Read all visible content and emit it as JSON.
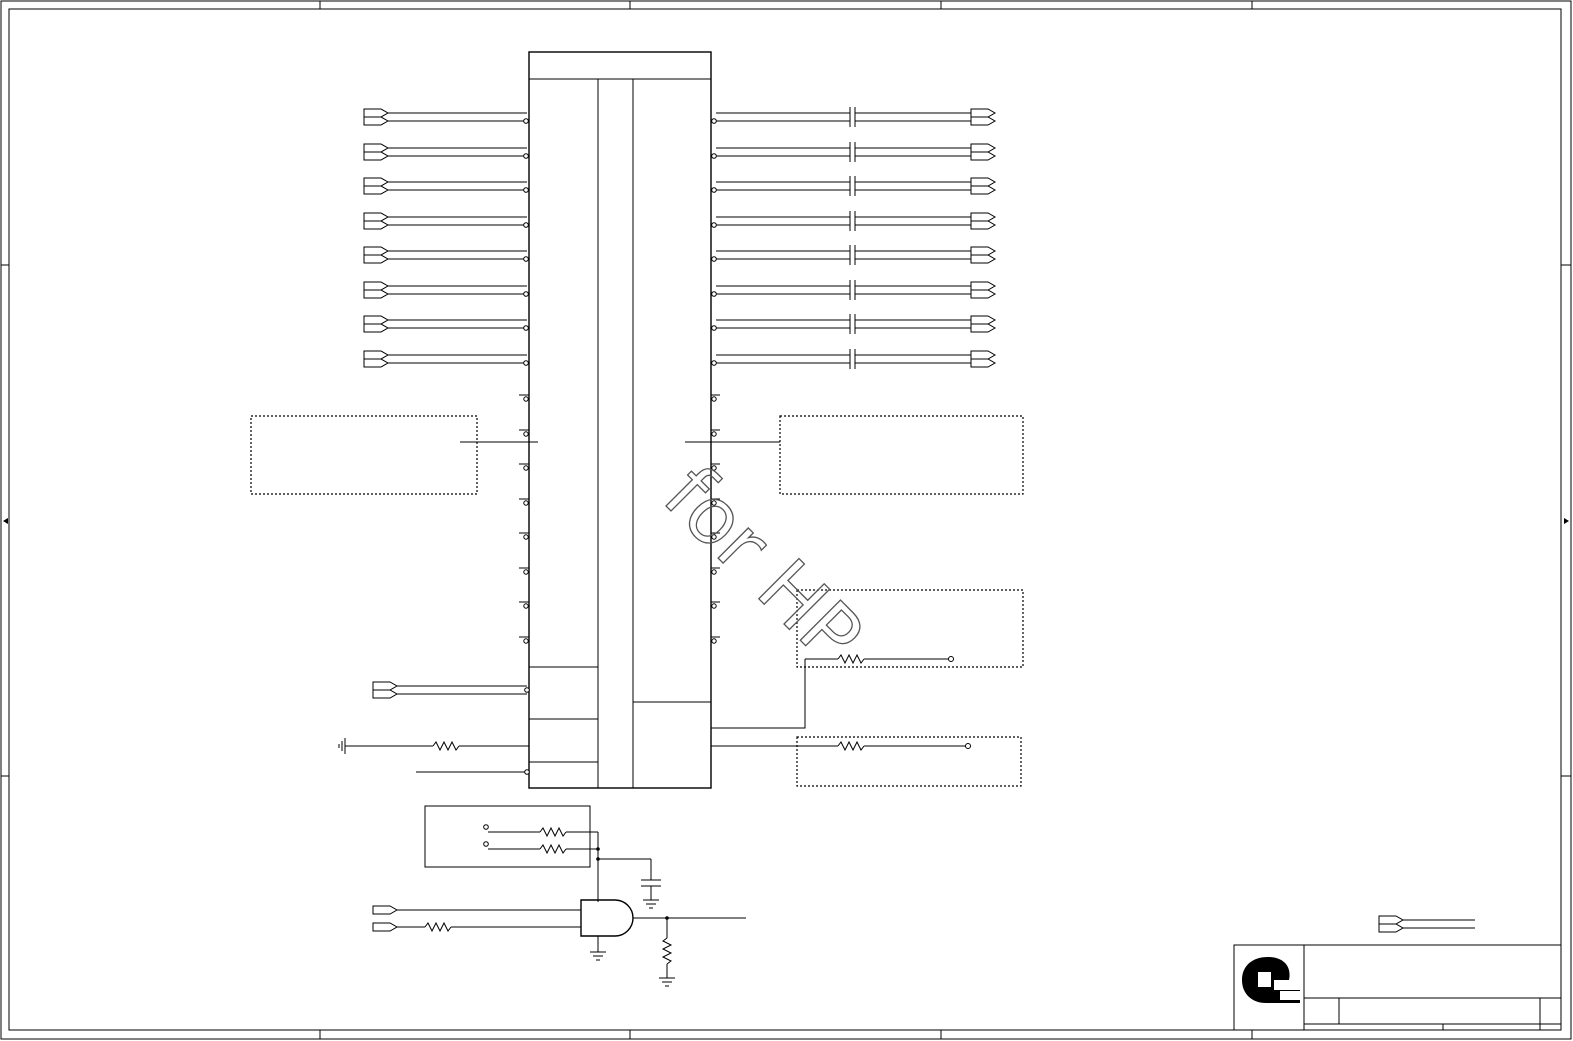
{
  "watermark": {
    "text": "for HP"
  },
  "colors": {
    "line": "#000000",
    "background": "#ffffff",
    "watermark": "#555555"
  },
  "title_block": {
    "logo": "Q"
  }
}
